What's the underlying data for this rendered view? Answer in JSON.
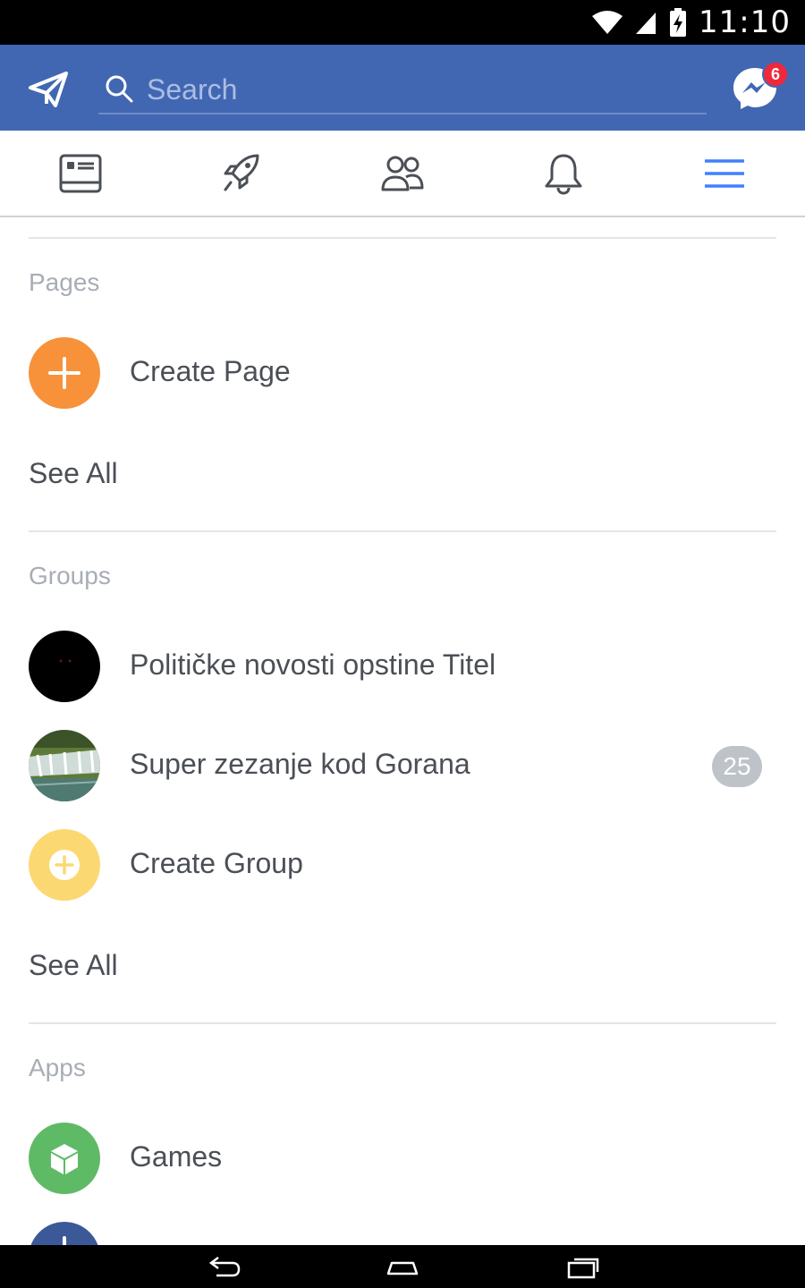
{
  "status_bar": {
    "time": "11:10"
  },
  "header": {
    "search_placeholder": "Search",
    "messenger_badge": "6"
  },
  "tabs": [
    {
      "name": "news-feed",
      "active": false
    },
    {
      "name": "explore",
      "active": false
    },
    {
      "name": "friends",
      "active": false
    },
    {
      "name": "notifications",
      "active": false
    },
    {
      "name": "menu",
      "active": true
    }
  ],
  "sections": {
    "pages": {
      "title": "Pages",
      "create_label": "Create Page",
      "see_all": "See All"
    },
    "groups": {
      "title": "Groups",
      "items": [
        {
          "label": "Političke novosti opstine Titel"
        },
        {
          "label": "Super zezanje kod Gorana",
          "count": "25"
        }
      ],
      "create_label": "Create Group",
      "see_all": "See All"
    },
    "apps": {
      "title": "Apps",
      "items": [
        {
          "label": "Games"
        }
      ]
    }
  },
  "colors": {
    "brand_blue": "#4267b2",
    "create_page_orange": "#f7923a",
    "create_group_yellow": "#fcd872",
    "games_green": "#5fba65",
    "badge_red": "#f0283c",
    "active_tab": "#4080ff"
  }
}
